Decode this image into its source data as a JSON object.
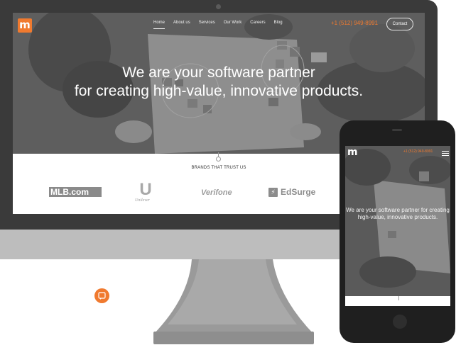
{
  "desktop": {
    "logo_letter": "m",
    "nav": {
      "items": [
        {
          "label": "Home",
          "active": true
        },
        {
          "label": "About us",
          "active": false
        },
        {
          "label": "Services",
          "active": false
        },
        {
          "label": "Our Work",
          "active": false
        },
        {
          "label": "Careers",
          "active": false
        },
        {
          "label": "Blog",
          "active": false
        }
      ]
    },
    "phone": "+1 (512) 949-8991",
    "contact_label": "Contact",
    "hero": {
      "line1": "We are your software partner",
      "line2": "for creating high-value, innovative products."
    },
    "brands": {
      "heading": "BRANDS THAT TRUST US",
      "mlb": "MLB.com",
      "unilever_letter": "U",
      "unilever": "Unilever",
      "verifone": "Verifone",
      "edsurge": "EdSurge"
    }
  },
  "mobile": {
    "logo_letter": "m",
    "phone": "+1 (512) 949-8991",
    "hero_text": "We are your software partner for creating high-value, innovative products."
  },
  "colors": {
    "accent": "#f07a2f",
    "device_dark": "#3a3a3a",
    "device_light": "#bdbdbd"
  },
  "icons": [
    "menu-icon",
    "chat-icon",
    "lightning-icon"
  ]
}
